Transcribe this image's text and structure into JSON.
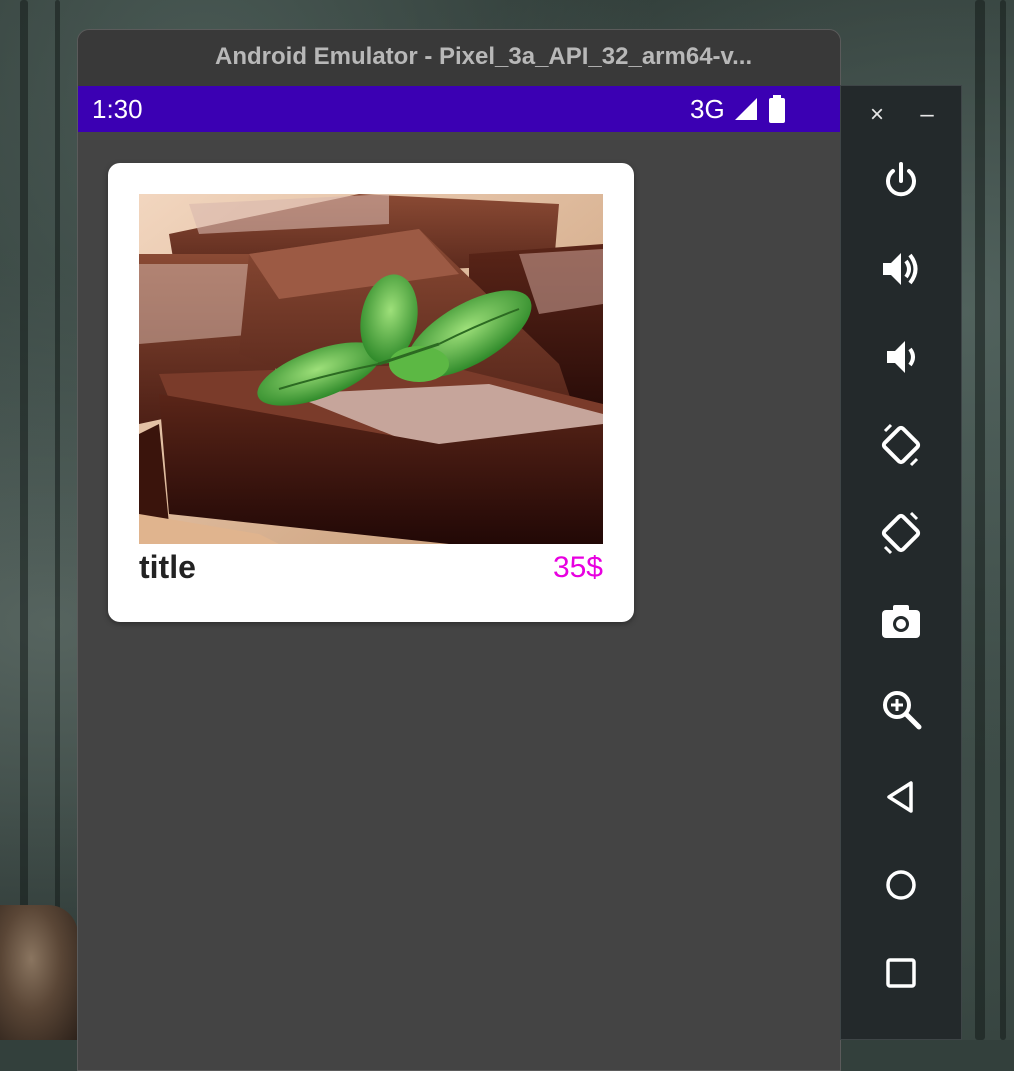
{
  "window": {
    "title": "Android Emulator - Pixel_3a_API_32_arm64-v..."
  },
  "status_bar": {
    "time": "1:30",
    "network": "3G",
    "background_color": "#3b00b3"
  },
  "product_card": {
    "image_icon": "brownie-with-mint-photo",
    "title": "title",
    "price": "35$",
    "price_color": "#e800e0"
  },
  "toolbar": {
    "close_symbol": "×",
    "minimize_symbol": "–",
    "buttons": [
      {
        "icon": "power-icon"
      },
      {
        "icon": "volume-up-icon"
      },
      {
        "icon": "volume-down-icon"
      },
      {
        "icon": "rotate-left-icon"
      },
      {
        "icon": "rotate-right-icon"
      },
      {
        "icon": "camera-icon"
      },
      {
        "icon": "zoom-icon"
      },
      {
        "icon": "back-icon"
      },
      {
        "icon": "home-icon"
      },
      {
        "icon": "overview-icon"
      }
    ]
  }
}
